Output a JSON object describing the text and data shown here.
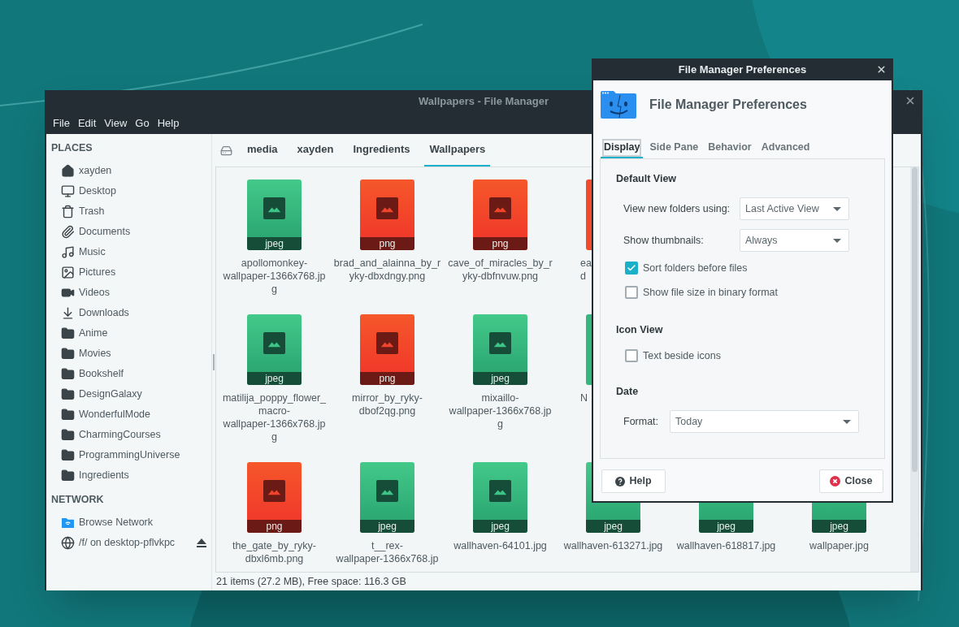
{
  "file_manager": {
    "title": "Wallpapers - File Manager",
    "menu": [
      "File",
      "Edit",
      "View",
      "Go",
      "Help"
    ],
    "sidebar": {
      "sections": [
        {
          "title": "PLACES",
          "items": [
            {
              "label": "xayden",
              "kind": "home"
            },
            {
              "label": "Desktop",
              "kind": "desktop"
            },
            {
              "label": "Trash",
              "kind": "trash"
            },
            {
              "label": "Documents",
              "kind": "documents"
            },
            {
              "label": "Music",
              "kind": "music"
            },
            {
              "label": "Pictures",
              "kind": "pictures"
            },
            {
              "label": "Videos",
              "kind": "videos"
            },
            {
              "label": "Downloads",
              "kind": "downloads"
            },
            {
              "label": "Anime",
              "kind": "folder"
            },
            {
              "label": "Movies",
              "kind": "folder"
            },
            {
              "label": "Bookshelf",
              "kind": "folder"
            },
            {
              "label": "DesignGalaxy",
              "kind": "folder"
            },
            {
              "label": "WonderfulMode",
              "kind": "folder"
            },
            {
              "label": "CharmingCourses",
              "kind": "folder"
            },
            {
              "label": "ProgrammingUniverse",
              "kind": "folder"
            },
            {
              "label": "Ingredients",
              "kind": "folder"
            }
          ]
        },
        {
          "title": "NETWORK",
          "items": [
            {
              "label": "Browse Network",
              "kind": "network"
            },
            {
              "label": "/f/ on desktop-pflvkpc",
              "kind": "mount"
            }
          ]
        }
      ]
    },
    "path": [
      {
        "label": "media",
        "selected": false
      },
      {
        "label": "xayden",
        "selected": false
      },
      {
        "label": "Ingredients",
        "selected": false
      },
      {
        "label": "Wallpapers",
        "selected": true
      }
    ],
    "rows": [
      [
        {
          "kind": "jpeg",
          "ext": "jpeg",
          "lines": [
            "apollomonkey-",
            "wallpaper-1366x768.jp",
            "g"
          ]
        },
        {
          "kind": "png",
          "ext": "png",
          "lines": [
            "brad_and_alainna_by_r",
            "yky-dbxdngy.png"
          ]
        },
        {
          "kind": "png",
          "ext": "png",
          "lines": [
            "cave_of_miracles_by_r",
            "yky-dbfnvuw.png"
          ]
        },
        {
          "kind": "partial",
          "color": "#f24a2a",
          "lines": [
            "ea",
            "d"
          ]
        }
      ],
      [
        {
          "kind": "jpeg",
          "ext": "jpeg",
          "lines": [
            "matilija_poppy_flower_",
            "macro-",
            "wallpaper-1366x768.jp",
            "g"
          ]
        },
        {
          "kind": "png",
          "ext": "png",
          "lines": [
            "mirror_by_ryky-",
            "dbof2qg.png"
          ]
        },
        {
          "kind": "jpeg",
          "ext": "jpeg",
          "lines": [
            "mixaillo-",
            "wallpaper-1366x768.jp",
            "g"
          ]
        },
        {
          "kind": "partial",
          "color": "#35b67d",
          "lines": [
            "N"
          ]
        }
      ],
      [
        {
          "kind": "png",
          "ext": "png",
          "lines": [
            "the_gate_by_ryky-",
            "dbxl6mb.png"
          ]
        },
        {
          "kind": "jpeg",
          "ext": "jpeg",
          "lines": [
            "t__rex-",
            "wallpaper-1366x768.jp"
          ]
        },
        {
          "kind": "jpeg",
          "ext": "jpeg",
          "lines": [
            "wallhaven-64101.jpg"
          ]
        },
        {
          "kind": "jpeg",
          "ext": "jpeg",
          "lines": [
            "wallhaven-613271.jpg"
          ]
        },
        {
          "kind": "jpeg",
          "ext": "jpeg",
          "lines": [
            "wallhaven-618817.jpg"
          ]
        },
        {
          "kind": "jpeg",
          "ext": "jpeg",
          "lines": [
            "wallpaper.jpg"
          ]
        }
      ]
    ],
    "status_bar": "21 items (27.2 MB), Free space: 116.3 GB"
  },
  "dialog": {
    "title": "File Manager Preferences",
    "heading": "File Manager Preferences",
    "tabs": [
      {
        "label": "Display",
        "selected": true
      },
      {
        "label": "Side Pane",
        "selected": false
      },
      {
        "label": "Behavior",
        "selected": false
      },
      {
        "label": "Advanced",
        "selected": false
      }
    ],
    "sections": [
      {
        "title": "Default View",
        "rows": [
          {
            "kind": "combo",
            "label": "View new folders using:",
            "value": "Last Active View"
          },
          {
            "kind": "combo",
            "label": "Show thumbnails:",
            "value": "Always"
          },
          {
            "kind": "check",
            "label": "Sort folders before files",
            "checked": true
          },
          {
            "kind": "check",
            "label": "Show file size in binary format",
            "checked": false
          }
        ]
      },
      {
        "title": "Icon View",
        "rows": [
          {
            "kind": "check",
            "label": "Text beside icons",
            "checked": false
          }
        ]
      },
      {
        "title": "Date",
        "rows": [
          {
            "kind": "wide_combo",
            "label": "Format:",
            "value": "Today"
          }
        ]
      }
    ],
    "buttons": [
      {
        "label": "Help",
        "kind": "help"
      },
      {
        "label": "Close",
        "kind": "close"
      }
    ]
  }
}
